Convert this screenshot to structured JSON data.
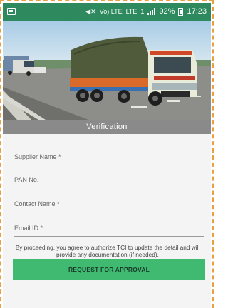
{
  "status_bar": {
    "signal_label": "Vo) LTE",
    "lte_label": "LTE",
    "sim_label": "1",
    "battery": "92%",
    "time": "17:23"
  },
  "header": {
    "title": "Verification"
  },
  "form": {
    "supplier_name_placeholder": "Supplier Name *",
    "pan_placeholder": "PAN No.",
    "contact_name_placeholder": "Contact Name *",
    "email_placeholder": "Email ID *",
    "notice": "By proceeding, you agree to authorize TCI to update the detail and will provide any documentation (if needed).",
    "submit_label": "REQUEST FOR APPROVAL"
  },
  "colors": {
    "status_bar": "#2e8a5e",
    "accent_button": "#3fba70",
    "header_bar": "#8a8a8a"
  }
}
